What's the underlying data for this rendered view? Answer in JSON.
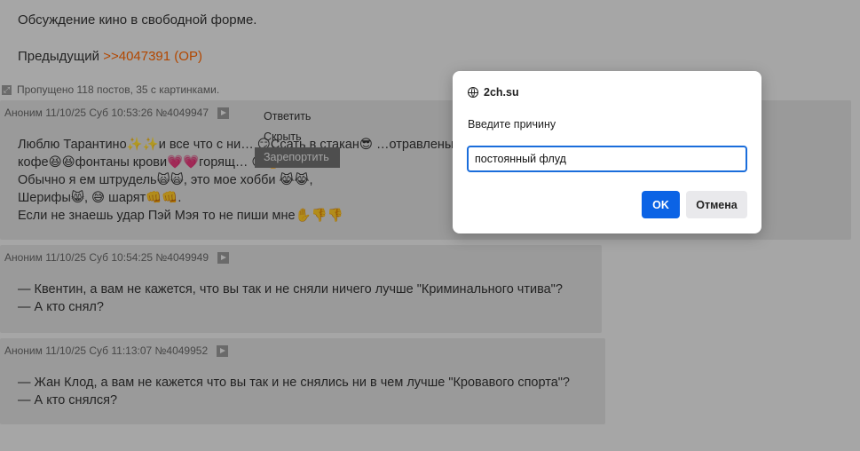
{
  "op": {
    "line1": "Обсуждение кино в свободной форме.",
    "prev_label": "Предыдущий",
    "prev_link": ">>4047391 (OP)"
  },
  "omitted": {
    "text": "Пропущено 118 постов, 35 с картинками."
  },
  "posts": [
    {
      "meta": "Аноним 11/10/25 Суб 10:53:26 №4049947",
      "lines": [
        "Люблю Тарантино✨✨и все что с ни… 😏Ссать в стакан😎 …отравленый",
        "кофе😆😆фонтаны крови💗💗горящ… 😊🔥",
        "Обычно я ем штрудель🙀🙀, это мое хобби 😹😹,",
        "Шерифы😸, 😅 шарят👊👊.",
        "Если не знаешь удар Пэй Мэя то не пиши мне✋👎👎"
      ]
    },
    {
      "meta": "Аноним 11/10/25 Суб 10:54:25 №4049949",
      "lines": [
        "— Квентин, а вам не кажется, что вы так и не сняли ничего лучше \"Криминального чтива\"?",
        "— А кто снял?"
      ]
    },
    {
      "meta": "Аноним 11/10/25 Суб 11:13:07 №4049952",
      "lines": [
        "— Жан Клод, а вам не кажется что вы так и не снялись ни в чем лучше \"Кровавого спорта\"?",
        "— А кто снялся?"
      ]
    }
  ],
  "context_menu": {
    "items": [
      "Ответить",
      "Скрыть",
      "Зарепортить"
    ]
  },
  "dialog": {
    "site": "2ch.su",
    "message": "Введите причину",
    "input_value": "постоянный флуд",
    "ok_label": "OK",
    "cancel_label": "Отмена"
  }
}
